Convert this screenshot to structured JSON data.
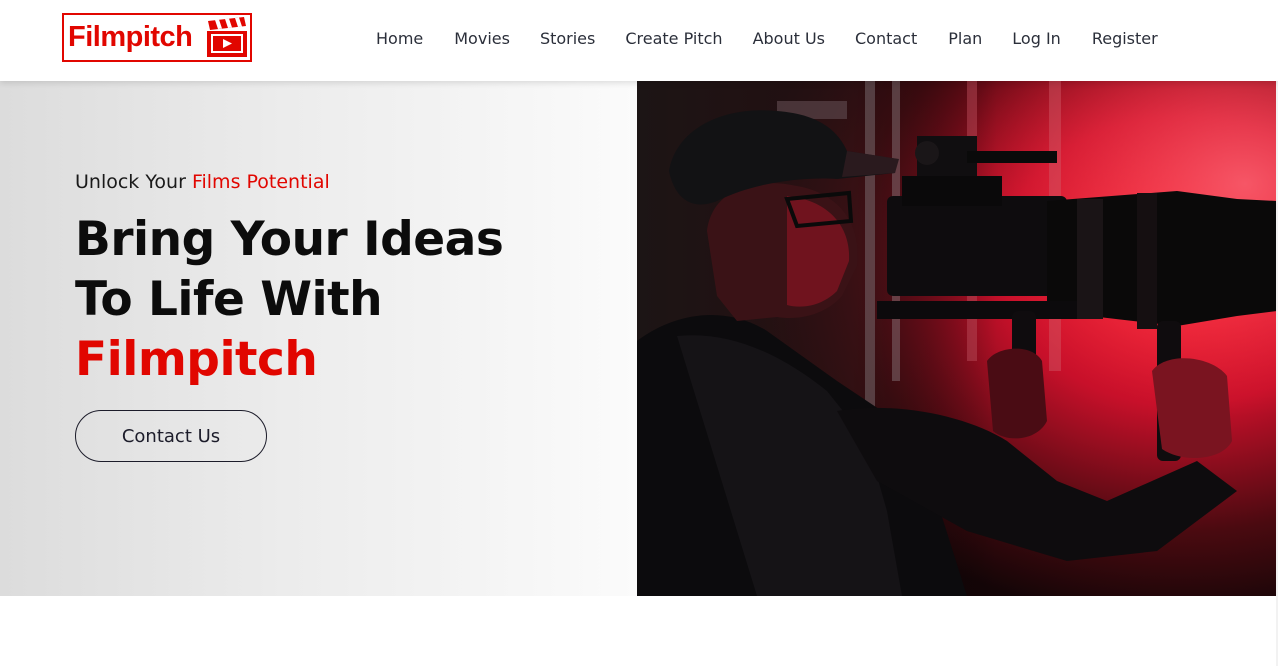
{
  "brand": {
    "name": "Filmpitch",
    "color": "#e10600",
    "icon": "clapperboard-play-icon"
  },
  "nav": {
    "items": [
      {
        "label": "Home"
      },
      {
        "label": "Movies"
      },
      {
        "label": "Stories"
      },
      {
        "label": "Create Pitch"
      },
      {
        "label": "About Us"
      },
      {
        "label": "Contact"
      },
      {
        "label": "Plan"
      },
      {
        "label": "Log In"
      },
      {
        "label": "Register"
      }
    ]
  },
  "hero": {
    "tagline_prefix": "Unlock Your",
    "tagline_accent": "Films Potential",
    "headline_line1": "Bring Your Ideas",
    "headline_line2": "To Life With",
    "headline_brand": "Filmpitch",
    "cta_label": "Contact Us",
    "image": "camera-operator-photo"
  },
  "colors": {
    "accent": "#e10600",
    "text_dark": "#0c0c0c",
    "nav_text": "#2b2f3a"
  }
}
